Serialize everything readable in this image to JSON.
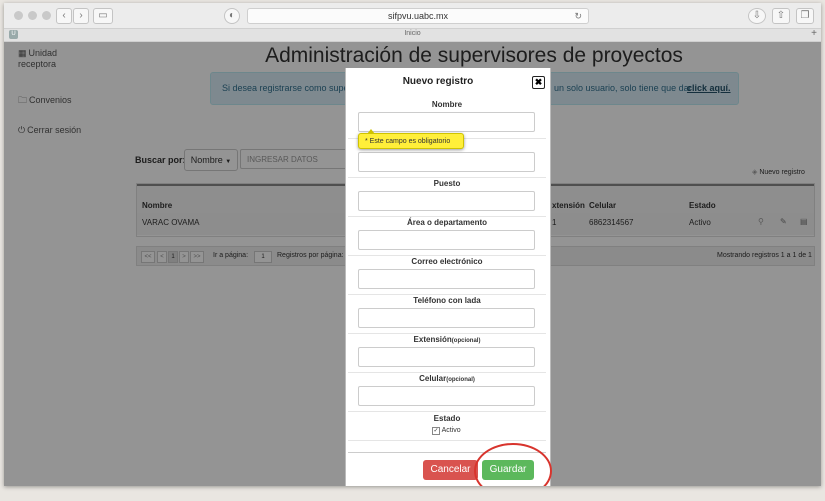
{
  "browser": {
    "url": "sifpvu.uabc.mx",
    "tab_title": "Inicio",
    "tab_left_badge": "U",
    "new_tab": "+"
  },
  "sidebar": {
    "items": [
      {
        "label": "Unidad receptora",
        "icon": "grid-icon"
      },
      {
        "label": "Convenios",
        "icon": "folder-icon"
      },
      {
        "label": "Cerrar sesión",
        "icon": "power-icon"
      }
    ]
  },
  "page": {
    "title": "Administración de supervisores de proyectos",
    "info_left": "Si desea registrarse como super",
    "info_right": "un solo usuario, solo tiene que dar",
    "info_link": "click aquí.",
    "search_label": "Buscar por:",
    "search_select": "Nombre",
    "search_placeholder": "INGRESAR DATOS",
    "new_record_link": "Nuevo registro",
    "table": {
      "headers": {
        "nombre": "Nombre",
        "extension": "xtensión",
        "celular": "Celular",
        "estado": "Estado"
      },
      "row": {
        "nombre": "VARAC OVAMA",
        "extension": "1",
        "celular": "6862314567",
        "estado": "Activo"
      }
    },
    "pager": {
      "first": "<<",
      "prev": "<",
      "page": "1",
      "next": ">",
      "last": ">>",
      "goto_label": "Ir a página:",
      "goto_value": "1",
      "per_page_label": "Registros por página:",
      "summary": "Mostrando registros 1 a 1 de 1"
    }
  },
  "modal": {
    "title": "Nuevo registro",
    "close": "✖",
    "fields": [
      {
        "label": "Nombre",
        "optional": ""
      },
      {
        "label": "",
        "optional": ""
      },
      {
        "label": "Puesto",
        "optional": ""
      },
      {
        "label": "Área o departamento",
        "optional": ""
      },
      {
        "label": "Correo electrónico",
        "optional": ""
      },
      {
        "label": "Teléfono con lada",
        "optional": ""
      },
      {
        "label": "Extensión",
        "optional": "(opcional)"
      },
      {
        "label": "Celular",
        "optional": "(opcional)"
      }
    ],
    "tooltip": "* Este campo es obligatorio",
    "estado_label": "Estado",
    "activo_label": "Activo",
    "activo_checked": true,
    "cancel": "Cancelar",
    "save": "Guardar"
  },
  "colors": {
    "cancel": "#d9534f",
    "save": "#5cb85c",
    "info_bg": "#d9edf7",
    "highlight_ring": "#d8342d",
    "tooltip": "#ffef3a"
  }
}
